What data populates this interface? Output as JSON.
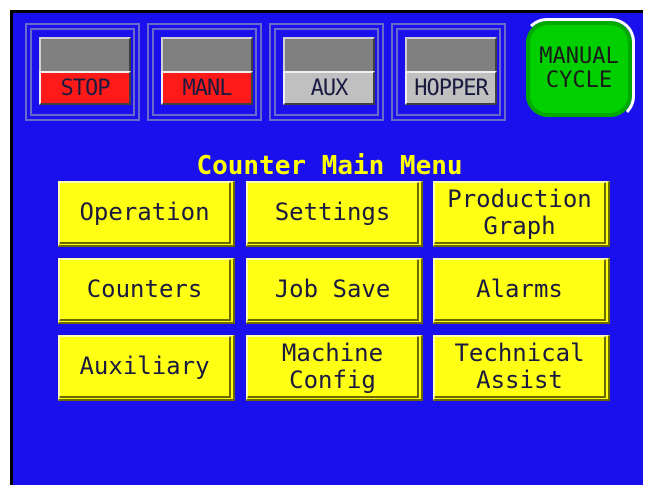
{
  "status_bar": {
    "indicators": [
      {
        "label": "STOP",
        "label_bg": "#ff1a1a",
        "label_color": "#1a1a40"
      },
      {
        "label": "MANL",
        "label_bg": "#ff1a1a",
        "label_color": "#1a1a40"
      },
      {
        "label": "AUX",
        "label_bg": "#c0c0c0",
        "label_color": "#1a1a40"
      },
      {
        "label": "HOPPER",
        "label_bg": "#c0c0c0",
        "label_color": "#1a1a40"
      }
    ],
    "cycle_button": {
      "line1": "MANUAL",
      "line2": "CYCLE",
      "color": "#00d000"
    }
  },
  "main": {
    "title": "Counter Main Menu",
    "buttons": [
      {
        "line1": "Operation",
        "line2": ""
      },
      {
        "line1": "Settings",
        "line2": ""
      },
      {
        "line1": "Production",
        "line2": "Graph"
      },
      {
        "line1": "Counters",
        "line2": ""
      },
      {
        "line1": "Job Save",
        "line2": ""
      },
      {
        "line1": "Alarms",
        "line2": ""
      },
      {
        "line1": "Auxiliary",
        "line2": ""
      },
      {
        "line1": "Machine",
        "line2": "Config"
      },
      {
        "line1": "Technical",
        "line2": "Assist"
      }
    ]
  },
  "colors": {
    "background": "#1a10ee",
    "button": "#ffff14",
    "title": "#ffff00"
  }
}
